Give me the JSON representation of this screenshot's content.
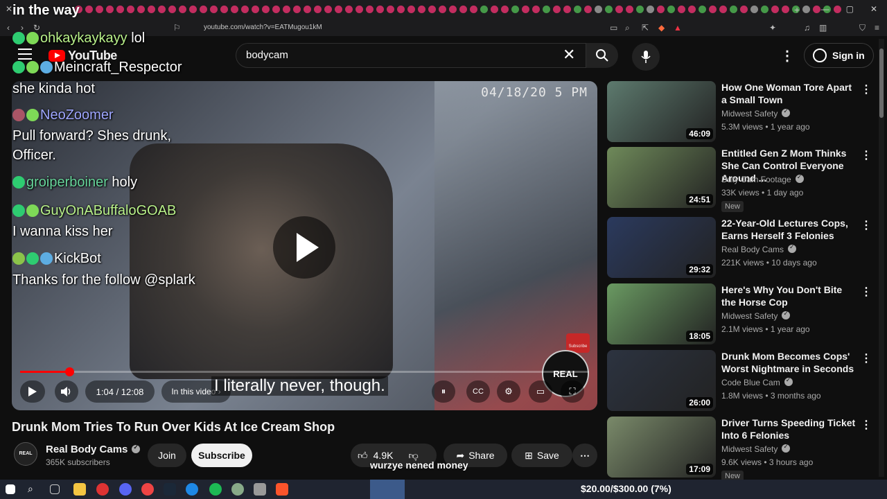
{
  "browser": {
    "url": "youtube.com/watch?v=EATMugou1kM",
    "window_controls": [
      "—",
      "▢",
      "✕"
    ]
  },
  "header": {
    "logo_text": "YouTube",
    "search_value": "bodycam",
    "sign_in_label": "Sign in"
  },
  "player": {
    "timestamp": "04/18/20   5 PM",
    "progress_fraction": 0.086,
    "time_label": "1:04 / 12:08",
    "in_this_video_label": "In this video ›",
    "caption_text": "I literally never, though.",
    "watermark_text": "REAL",
    "subscribe_badge": "Subscribe"
  },
  "overlay": {
    "top_text": "in the way",
    "chat": [
      {
        "name": "ohkaykaykayy",
        "message": "lol"
      },
      {
        "name": "Meincraft_Respector",
        "message": ""
      },
      {
        "name": "",
        "message": "she kinda hot"
      },
      {
        "name": "NeoZoomer",
        "message": ""
      },
      {
        "name": "",
        "message": "Pull forward? Shes drunk,"
      },
      {
        "name": "",
        "message": "Officer."
      },
      {
        "name": "groiperboiner",
        "message": "holy"
      },
      {
        "name": "GuyOnABuffaloGOAB",
        "message": ""
      },
      {
        "name": "",
        "message": "I wanna kiss her"
      },
      {
        "name": "KickBot",
        "message": ""
      },
      {
        "name": "",
        "message": "Thanks for the follow @splark"
      }
    ],
    "donation_text": "wurzye nened money"
  },
  "video": {
    "title": "Drunk Mom Tries To Run Over Kids At Ice Cream Shop",
    "channel": "Real Body Cams",
    "channel_avatar": "REAL",
    "subscribers": "365K subscribers",
    "join_label": "Join",
    "subscribe_label": "Subscribe",
    "likes": "4.9K",
    "share_label": "Share",
    "save_label": "Save"
  },
  "recommendations": [
    {
      "title": "How One Woman Tore Apart a Small Town",
      "channel": "Midwest Safety",
      "meta": "5.3M views • 1 year ago",
      "duration": "46:09",
      "new": "",
      "color": "#5d7a6e"
    },
    {
      "title": "Entitled Gen Z Mom Thinks She Can Control Everyone Around ...",
      "channel": "Duty Cam Footage",
      "meta": "33K views • 1 day ago",
      "duration": "24:51",
      "new": "New",
      "color": "#6f8a5a"
    },
    {
      "title": "22-Year-Old Lectures Cops, Earns Herself 3 Felonies",
      "channel": "Real Body Cams",
      "meta": "221K views • 10 days ago",
      "duration": "29:32",
      "new": "",
      "color": "#2b3a5e"
    },
    {
      "title": "Here's Why You Don't Bite the Horse Cop",
      "channel": "Midwest Safety",
      "meta": "2.1M views • 1 year ago",
      "duration": "18:05",
      "new": "",
      "color": "#6a9a62"
    },
    {
      "title": "Drunk Mom Becomes Cops' Worst Nightmare in Seconds",
      "channel": "Code Blue Cam",
      "meta": "1.8M views • 3 months ago",
      "duration": "26:00",
      "new": "",
      "color": "#2c3340"
    },
    {
      "title": "Driver Turns Speeding Ticket Into 6 Felonies",
      "channel": "Midwest Safety",
      "meta": "9.6K views • 3 hours ago",
      "duration": "17:09",
      "new": "New",
      "color": "#7a8a6a"
    }
  ],
  "taskbar": {
    "goal_text": "$20.00/$300.00 (7%)"
  }
}
